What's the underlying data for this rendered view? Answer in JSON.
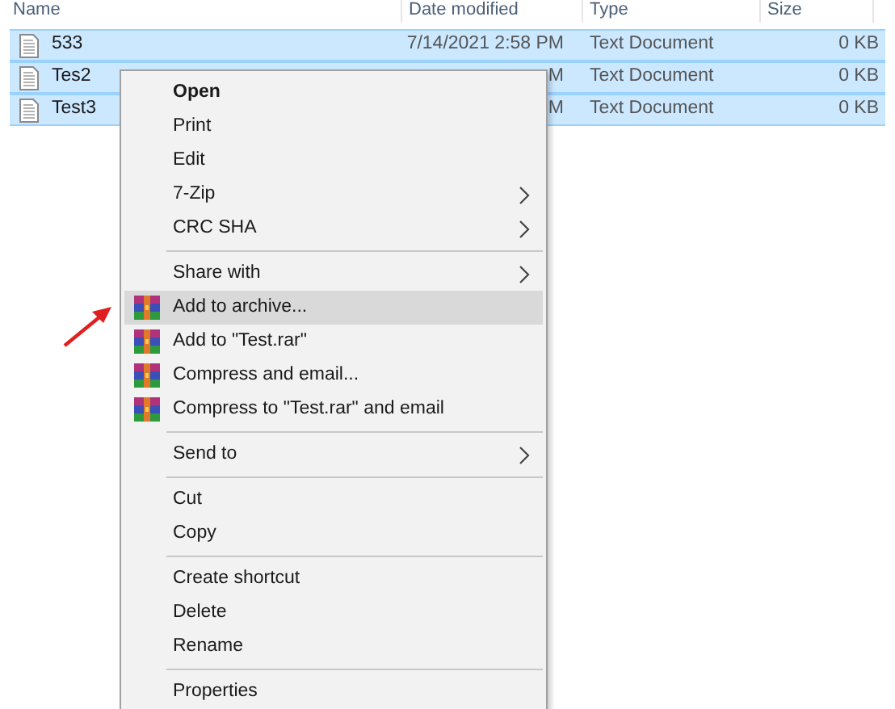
{
  "columns": [
    {
      "label": "Name"
    },
    {
      "label": "Date modified"
    },
    {
      "label": "Type"
    },
    {
      "label": "Size"
    }
  ],
  "rows": [
    {
      "name": "533",
      "date": "7/14/2021 2:58 PM",
      "type": "Text Document",
      "size": "0 KB",
      "selected": true
    },
    {
      "name": "Tes2",
      "date": "M",
      "type": "Text Document",
      "size": "0 KB",
      "selected": true
    },
    {
      "name": "Test3",
      "date": "M",
      "type": "Text Document",
      "size": "0 KB",
      "selected": true
    }
  ],
  "context_menu": {
    "items": [
      {
        "kind": "default",
        "label": "Open",
        "selected": false
      },
      {
        "kind": "item",
        "label": "Print",
        "selected": false
      },
      {
        "kind": "item",
        "label": "Edit",
        "selected": false
      },
      {
        "kind": "submenu",
        "label": "7-Zip",
        "selected": false
      },
      {
        "kind": "submenu",
        "label": "CRC SHA",
        "selected": false
      },
      {
        "kind": "separator"
      },
      {
        "kind": "submenu",
        "label": "Share with",
        "selected": false
      },
      {
        "kind": "archive",
        "label": "Add to archive...",
        "selected": true
      },
      {
        "kind": "archive",
        "label": "Add to \"Test.rar\"",
        "selected": false
      },
      {
        "kind": "archive",
        "label": "Compress and email...",
        "selected": false
      },
      {
        "kind": "archive",
        "label": "Compress to \"Test.rar\" and email",
        "selected": false
      },
      {
        "kind": "separator"
      },
      {
        "kind": "submenu",
        "label": "Send to",
        "selected": false
      },
      {
        "kind": "separator"
      },
      {
        "kind": "item",
        "label": "Cut",
        "selected": false
      },
      {
        "kind": "item",
        "label": "Copy",
        "selected": false
      },
      {
        "kind": "separator"
      },
      {
        "kind": "item",
        "label": "Create shortcut",
        "selected": false
      },
      {
        "kind": "item",
        "label": "Delete",
        "selected": false
      },
      {
        "kind": "item",
        "label": "Rename",
        "selected": false
      },
      {
        "kind": "separator"
      },
      {
        "kind": "item",
        "label": "Properties",
        "selected": false
      }
    ]
  }
}
